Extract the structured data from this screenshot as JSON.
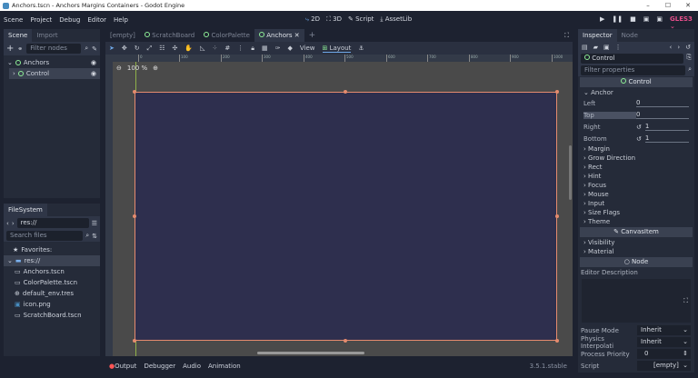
{
  "window": {
    "title": "Anchors.tscn - Anchors Margins Containers - Godot Engine",
    "minimize": "–",
    "maximize": "☐",
    "close": "✕"
  },
  "menu": [
    "Scene",
    "Project",
    "Debug",
    "Editor",
    "Help"
  ],
  "workspaces": [
    "2D",
    "3D",
    "Script",
    "AssetLib"
  ],
  "renderer": "GLES3",
  "scene_dock": {
    "tabs": [
      "Scene",
      "Import"
    ],
    "filter_placeholder": "Filter nodes",
    "nodes": [
      "Anchors",
      "Control"
    ]
  },
  "filesystem": {
    "title": "FileSystem",
    "path": "res://",
    "search_placeholder": "Search files",
    "favorites": "Favorites:",
    "root": "res://",
    "files": [
      "Anchors.tscn",
      "ColorPalette.tscn",
      "default_env.tres",
      "icon.png",
      "ScratchBoard.tscn"
    ]
  },
  "editor_tabs": [
    "[empty]",
    "ScratchBoard",
    "ColorPalette",
    "Anchors"
  ],
  "toolbar": {
    "view": "View",
    "layout": "Layout"
  },
  "viewport": {
    "zoom": "100 %",
    "ruler_labels": [
      "0",
      "100",
      "200",
      "300",
      "400",
      "500",
      "600",
      "700",
      "800",
      "900",
      "1000"
    ]
  },
  "bottom": {
    "tabs": [
      "Output",
      "Debugger",
      "Audio",
      "Animation"
    ],
    "version": "3.5.1.stable"
  },
  "inspector": {
    "tabs": [
      "Inspector",
      "Node"
    ],
    "object": "Control",
    "filter_placeholder": "Filter properties",
    "cat_control": "Control",
    "anchor": "Anchor",
    "anchors": [
      {
        "label": "Left",
        "value": "0"
      },
      {
        "label": "Top",
        "value": "0"
      },
      {
        "label": "Right",
        "value": "1"
      },
      {
        "label": "Bottom",
        "value": "1"
      }
    ],
    "sections1": [
      "Margin",
      "Grow Direction",
      "Rect",
      "Hint",
      "Focus",
      "Mouse",
      "Input",
      "Size Flags",
      "Theme"
    ],
    "cat_canvas": "CanvasItem",
    "sections2": [
      "Visibility",
      "Material"
    ],
    "cat_node": "Node",
    "editor_description": "Editor Description",
    "props": [
      {
        "label": "Pause Mode",
        "value": "Inherit"
      },
      {
        "label": "Physics Interpolati",
        "value": "Inherit"
      },
      {
        "label": "Process Priority",
        "value": "0"
      },
      {
        "label": "Script",
        "value": "[empty]"
      }
    ]
  }
}
